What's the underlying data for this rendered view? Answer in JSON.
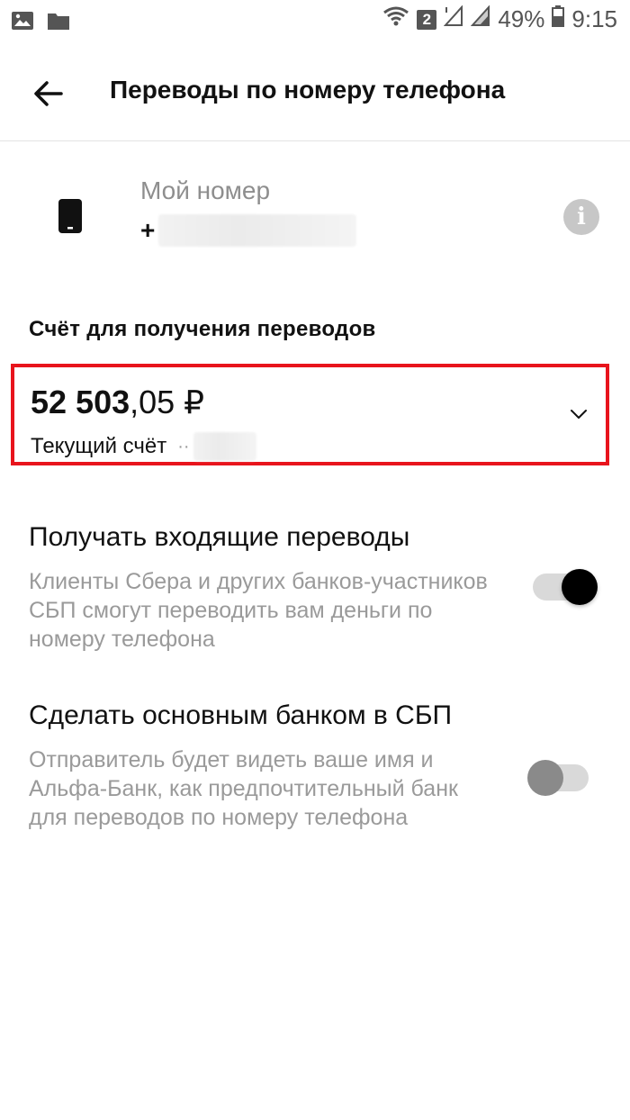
{
  "status_bar": {
    "sim_number": "2",
    "battery_percent": "49%",
    "time": "9:15",
    "icons": [
      "image-icon",
      "folder-icon",
      "wifi-icon",
      "signal-icon",
      "battery-icon"
    ]
  },
  "toolbar": {
    "title": "Переводы по номеру телефона",
    "back_icon": "arrow-left-icon"
  },
  "my_number": {
    "label": "Мой номер",
    "value_prefix": "+"
  },
  "account_section": {
    "title": "Счёт для получения переводов",
    "balance_int": "52 503",
    "balance_frac": ",05 ₽",
    "account_name": "Текущий счёт",
    "account_mask": "··"
  },
  "incoming": {
    "title": "Получать входящие переводы",
    "description": "Клиенты Сбера и других банков-участников СБП смогут переводить вам деньги по номеру телефона",
    "enabled": true
  },
  "main_bank": {
    "title": "Сделать основным банком в СБП",
    "description": "Отправитель будет видеть ваше имя и Альфа-Банк, как предпочтительный банк для переводов по номеру телефона",
    "enabled": false
  },
  "colors": {
    "accent_highlight": "#e8141c",
    "toggle_on": "#000000",
    "toggle_off": "#8a8a8a"
  }
}
